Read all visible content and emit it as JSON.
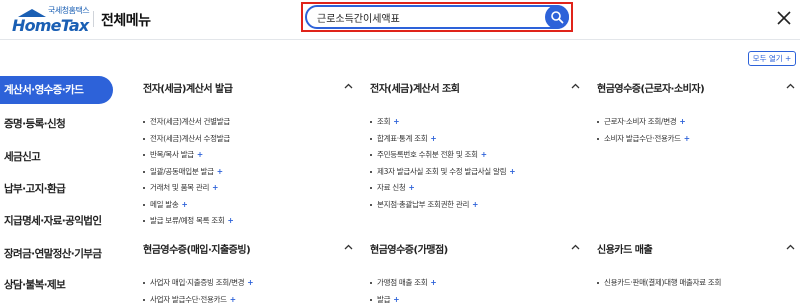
{
  "header": {
    "logo_sub": "국세청홈택스",
    "logo_main": "HomeTax",
    "menu_title": "전체메뉴",
    "search_value": "근로소득간이세액표",
    "expand_all_label": "모두 열기 +"
  },
  "sidebar": {
    "items": [
      {
        "label": "계산서·영수증·카드",
        "active": true
      },
      {
        "label": "증명·등록·신청"
      },
      {
        "label": "세금신고"
      },
      {
        "label": "납부·고지·환급"
      },
      {
        "label": "지급명세·자료·공익법인"
      },
      {
        "label": "장려금·연말정산·기부금"
      },
      {
        "label": "상담·불복·제보"
      }
    ]
  },
  "sections": [
    {
      "title": "전자(세금)계산서 발급",
      "items": [
        {
          "label": "전자(세금)계산서 건별발급",
          "plus": false
        },
        {
          "label": "전자(세금)계산서 수정발급",
          "plus": false
        },
        {
          "label": "반복/복사 발급",
          "plus": true
        },
        {
          "label": "일괄/공동매입분 발급",
          "plus": true
        },
        {
          "label": "거래처 및 품목 관리",
          "plus": true
        },
        {
          "label": "메일 발송",
          "plus": true
        },
        {
          "label": "발급 보류/예정 목록 조회",
          "plus": true
        }
      ]
    },
    {
      "title": "전자(세금)계산서 조회",
      "items": [
        {
          "label": "조회",
          "plus": true
        },
        {
          "label": "합계표·통계 조회",
          "plus": true
        },
        {
          "label": "주민등록번호 수취분 전환 및 조회",
          "plus": true
        },
        {
          "label": "제3자 발급사실 조회 및 수정 발급사실 알림",
          "plus": true
        },
        {
          "label": "자료 신청",
          "plus": true
        },
        {
          "label": "본지점·총괄납부 조회권한 관리",
          "plus": true
        }
      ]
    },
    {
      "title": "현금영수증(근로자·소비자)",
      "items": [
        {
          "label": "근로자·소비자 조회/변경",
          "plus": true
        },
        {
          "label": "소비자 발급수단·전용카드",
          "plus": true
        }
      ]
    },
    {
      "title": "현금영수증(매입·지출증빙)",
      "items": [
        {
          "label": "사업자 매입·지출증빙 조회/변경",
          "plus": true
        },
        {
          "label": "사업자 발급수단·전용카드",
          "plus": true
        }
      ]
    },
    {
      "title": "현금영수증(가맹점)",
      "items": [
        {
          "label": "가맹점 매출 조회",
          "plus": true
        },
        {
          "label": "발급",
          "plus": true
        }
      ]
    },
    {
      "title": "신용카드 매출",
      "items": [
        {
          "label": "신용카드·판매(결제)대행 매출자료 조회",
          "plus": false
        }
      ]
    }
  ],
  "colors": {
    "brand_blue": "#2d62d9",
    "highlight_red": "#e0241a",
    "logo_blue": "#1a5fb4"
  },
  "icons": {
    "search": "search-icon",
    "close": "close-icon",
    "chevron": "chevron-up-icon"
  }
}
